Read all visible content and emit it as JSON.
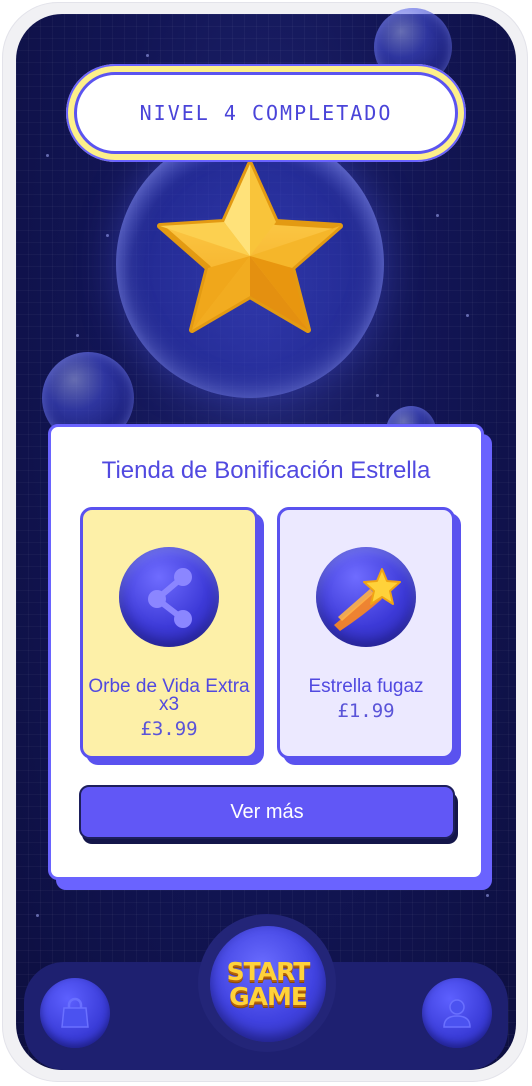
{
  "level_banner": {
    "text": "NIVEL 4 COMPLETADO"
  },
  "shop": {
    "title": "Tienda de Bonificación Estrella",
    "items": [
      {
        "name_line1": "Orbe de Vida Extra",
        "name_line2": "x3",
        "price": "£3.99",
        "icon": "share-nodes-icon"
      },
      {
        "name_line1": "Estrella fugaz",
        "name_line2": "",
        "price": "£1.99",
        "icon": "shooting-star-icon"
      }
    ],
    "more_label": "Ver más"
  },
  "nav": {
    "start_line1": "START",
    "start_line2": "GAME",
    "left_icon": "shopping-bag-icon",
    "right_icon": "user-icon"
  },
  "colors": {
    "accent": "#6157f6",
    "banner_yellow": "#fdf08a",
    "star_gold": "#f7b928",
    "background": "#121555"
  }
}
